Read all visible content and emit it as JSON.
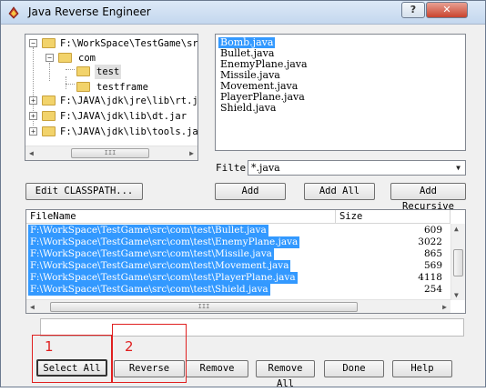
{
  "window": {
    "title": "Java Reverse Engineer",
    "help_label": "?",
    "close_label": "✕"
  },
  "tree": {
    "nodes": [
      {
        "label": "F:\\WorkSpace\\TestGame\\src",
        "expander": "−"
      },
      {
        "label": "com",
        "expander": "−"
      },
      {
        "label": "test"
      },
      {
        "label": "testframe"
      },
      {
        "label": "F:\\JAVA\\jdk\\jre\\lib\\rt.ja",
        "expander": "+"
      },
      {
        "label": "F:\\JAVA\\jdk\\lib\\dt.jar",
        "expander": "+"
      },
      {
        "label": "F:\\JAVA\\jdk\\lib\\tools.jar",
        "expander": "+"
      }
    ],
    "scroll_thumb": "III"
  },
  "files": [
    "Bomb.java",
    "Bullet.java",
    "EnemyPlane.java",
    "Missile.java",
    "Movement.java",
    "PlayerPlane.java",
    "Shield.java"
  ],
  "filter": {
    "label": "Filte",
    "value": "*.java"
  },
  "buttons": {
    "edit_classpath": "Edit CLASSPATH...",
    "add": "Add",
    "add_all": "Add All",
    "add_recursive": "Add Recursive",
    "select_all": "Select All",
    "reverse": "Reverse",
    "remove": "Remove",
    "remove_all": "Remove All",
    "done": "Done",
    "help": "Help"
  },
  "table": {
    "columns": [
      "FileName",
      "Size"
    ],
    "rows": [
      {
        "path": "F:\\WorkSpace\\TestGame\\src\\com\\test\\Bullet.java",
        "size": "609"
      },
      {
        "path": "F:\\WorkSpace\\TestGame\\src\\com\\test\\EnemyPlane.java",
        "size": "3022"
      },
      {
        "path": "F:\\WorkSpace\\TestGame\\src\\com\\test\\Missile.java",
        "size": "865"
      },
      {
        "path": "F:\\WorkSpace\\TestGame\\src\\com\\test\\Movement.java",
        "size": "569"
      },
      {
        "path": "F:\\WorkSpace\\TestGame\\src\\com\\test\\PlayerPlane.java",
        "size": "4118"
      },
      {
        "path": "F:\\WorkSpace\\TestGame\\src\\com\\test\\Shield.java",
        "size": "254"
      }
    ],
    "scroll_thumb": "III"
  },
  "progress": {
    "value": 0
  },
  "annotations": [
    "1",
    "2"
  ],
  "colors": {
    "selection": "#3399ff",
    "annotation": "#e02020"
  }
}
